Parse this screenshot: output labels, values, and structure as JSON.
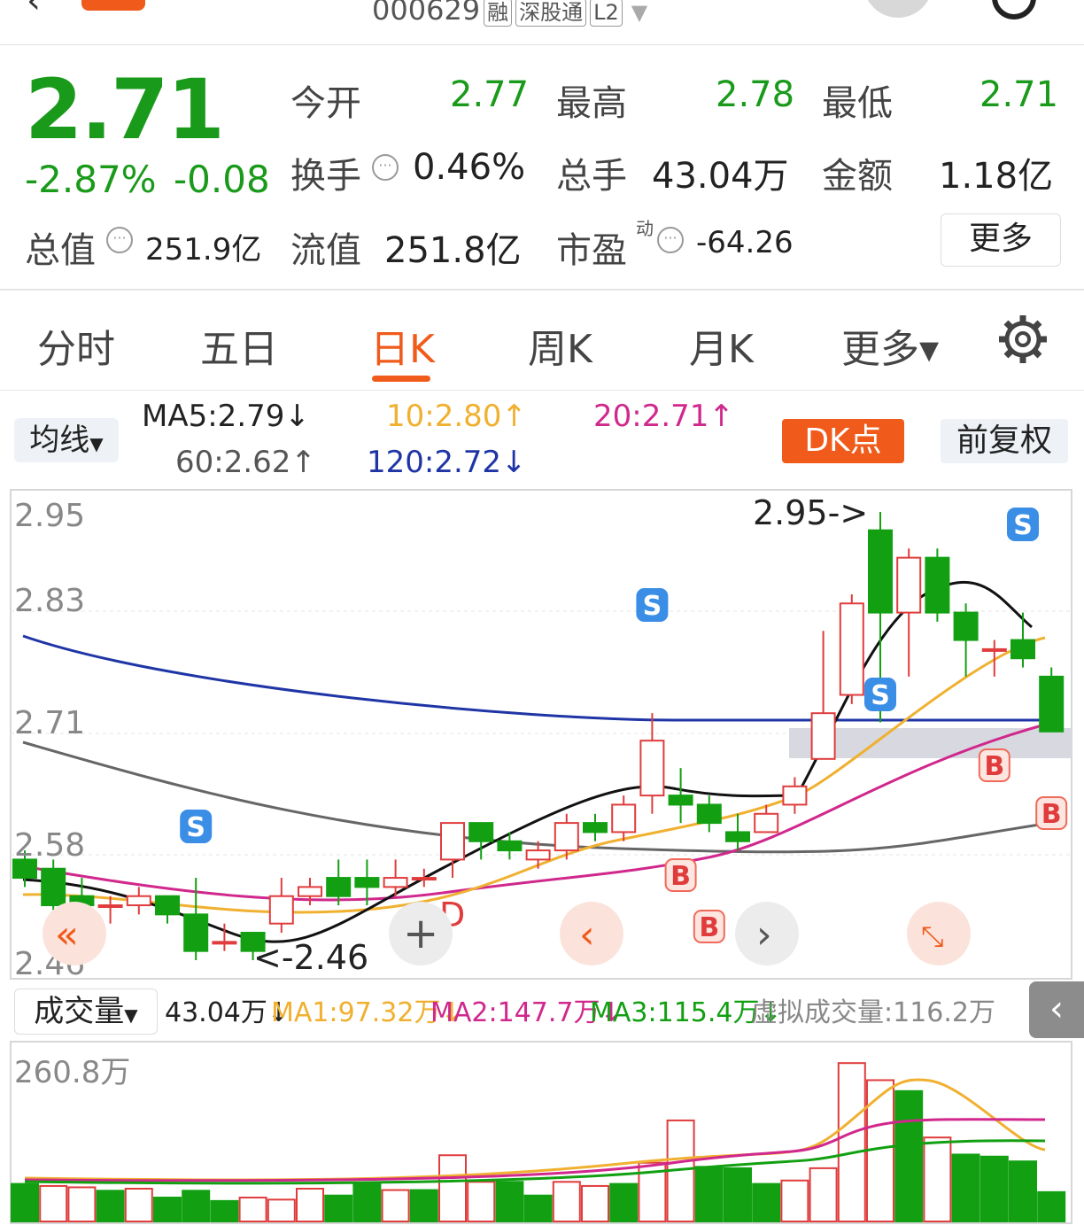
{
  "header": {
    "code": "000629",
    "tags": [
      "融",
      "深股通",
      "L2"
    ]
  },
  "quote": {
    "price": "2.71",
    "change_pct": "-2.87%",
    "change": "-0.08",
    "open_label": "今开",
    "open": "2.77",
    "high_label": "最高",
    "high": "2.78",
    "low_label": "最低",
    "low": "2.71",
    "turnover_label": "换手",
    "turnover": "0.46%",
    "volume_label": "总手",
    "volume": "43.04万",
    "amount_label": "金额",
    "amount": "1.18亿",
    "mktcap_label": "总值",
    "mktcap": "251.9亿",
    "float_label": "流值",
    "float": "251.8亿",
    "pe_label": "市盈",
    "pe_sup": "动",
    "pe": "-64.26",
    "more_label": "更多"
  },
  "tabs": [
    "分时",
    "五日",
    "日K",
    "周K",
    "月K",
    "更多▾"
  ],
  "active_tab": "日K",
  "ma_bar": {
    "selector": "均线",
    "ma5": "MA5:2.79↓",
    "ma10": "10:2.80↑",
    "ma20": "20:2.71↑",
    "ma60": "60:2.62↑",
    "ma120": "120:2.72↓",
    "dk_label": "DK点",
    "adjust_label": "前复权"
  },
  "price_axis": [
    "2.95",
    "2.83",
    "2.71",
    "2.58",
    "2.46"
  ],
  "annotations": {
    "high": "2.95->",
    "low": "<-2.46",
    "d_mark": "D",
    "s": "S",
    "b": "B"
  },
  "volume_bar": {
    "selector": "成交量",
    "vol": "43.04万↓",
    "ma1": "MA1:97.32万↓",
    "ma2": "MA2:147.7万↓",
    "ma3": "MA3:115.4万↓",
    "virtual": "虚拟成交量:116.2万",
    "axis_top": "260.8万"
  },
  "colors": {
    "up": "#e03c3c",
    "down": "#12a012",
    "accent": "#f05a1a",
    "ma5": "#111111",
    "ma10": "#f0b030",
    "ma20": "#d0288c",
    "ma60": "#666666",
    "ma120": "#1f35a5"
  },
  "chart_data": {
    "type": "candlestick",
    "candles": [
      {
        "o": 2.57,
        "c": 2.55,
        "h": 2.58,
        "l": 2.54
      },
      {
        "o": 2.56,
        "c": 2.52,
        "h": 2.57,
        "l": 2.51
      },
      {
        "o": 2.53,
        "c": 2.52,
        "h": 2.55,
        "l": 2.5
      },
      {
        "o": 2.52,
        "c": 2.52,
        "h": 2.53,
        "l": 2.5
      },
      {
        "o": 2.52,
        "c": 2.53,
        "h": 2.54,
        "l": 2.51
      },
      {
        "o": 2.53,
        "c": 2.51,
        "h": 2.53,
        "l": 2.5
      },
      {
        "o": 2.51,
        "c": 2.47,
        "h": 2.55,
        "l": 2.46
      },
      {
        "o": 2.48,
        "c": 2.48,
        "h": 2.5,
        "l": 2.47
      },
      {
        "o": 2.49,
        "c": 2.47,
        "h": 2.49,
        "l": 2.46
      },
      {
        "o": 2.5,
        "c": 2.53,
        "h": 2.55,
        "l": 2.49
      },
      {
        "o": 2.53,
        "c": 2.54,
        "h": 2.55,
        "l": 2.52
      },
      {
        "o": 2.55,
        "c": 2.53,
        "h": 2.57,
        "l": 2.52
      },
      {
        "o": 2.55,
        "c": 2.54,
        "h": 2.57,
        "l": 2.52
      },
      {
        "o": 2.54,
        "c": 2.55,
        "h": 2.57,
        "l": 2.53
      },
      {
        "o": 2.55,
        "c": 2.55,
        "h": 2.56,
        "l": 2.54
      },
      {
        "o": 2.57,
        "c": 2.61,
        "h": 2.61,
        "l": 2.55
      },
      {
        "o": 2.61,
        "c": 2.59,
        "h": 2.61,
        "l": 2.57
      },
      {
        "o": 2.59,
        "c": 2.58,
        "h": 2.6,
        "l": 2.57
      },
      {
        "o": 2.57,
        "c": 2.58,
        "h": 2.59,
        "l": 2.56
      },
      {
        "o": 2.58,
        "c": 2.61,
        "h": 2.62,
        "l": 2.57
      },
      {
        "o": 2.61,
        "c": 2.6,
        "h": 2.62,
        "l": 2.59
      },
      {
        "o": 2.6,
        "c": 2.63,
        "h": 2.64,
        "l": 2.59
      },
      {
        "o": 2.64,
        "c": 2.7,
        "h": 2.73,
        "l": 2.62
      },
      {
        "o": 2.64,
        "c": 2.63,
        "h": 2.67,
        "l": 2.61
      },
      {
        "o": 2.63,
        "c": 2.61,
        "h": 2.64,
        "l": 2.6
      },
      {
        "o": 2.6,
        "c": 2.59,
        "h": 2.62,
        "l": 2.58
      },
      {
        "o": 2.6,
        "c": 2.62,
        "h": 2.63,
        "l": 2.6
      },
      {
        "o": 2.63,
        "c": 2.65,
        "h": 2.66,
        "l": 2.62
      },
      {
        "o": 2.68,
        "c": 2.73,
        "h": 2.82,
        "l": 2.68
      },
      {
        "o": 2.75,
        "c": 2.85,
        "h": 2.86,
        "l": 2.74
      },
      {
        "o": 2.93,
        "c": 2.84,
        "h": 2.95,
        "l": 2.72
      },
      {
        "o": 2.84,
        "c": 2.9,
        "h": 2.91,
        "l": 2.77
      },
      {
        "o": 2.9,
        "c": 2.84,
        "h": 2.91,
        "l": 2.83
      },
      {
        "o": 2.84,
        "c": 2.81,
        "h": 2.85,
        "l": 2.77
      },
      {
        "o": 2.8,
        "c": 2.8,
        "h": 2.81,
        "l": 2.77
      },
      {
        "o": 2.81,
        "c": 2.79,
        "h": 2.84,
        "l": 2.78
      },
      {
        "o": 2.77,
        "c": 2.71,
        "h": 2.78,
        "l": 2.71
      }
    ],
    "volume": [
      {
        "v": 55,
        "up": false
      },
      {
        "v": 52,
        "up": true
      },
      {
        "v": 50,
        "up": true
      },
      {
        "v": 45,
        "up": false
      },
      {
        "v": 48,
        "up": true
      },
      {
        "v": 35,
        "up": false
      },
      {
        "v": 45,
        "up": false
      },
      {
        "v": 30,
        "up": false
      },
      {
        "v": 35,
        "up": true
      },
      {
        "v": 32,
        "up": true
      },
      {
        "v": 48,
        "up": true
      },
      {
        "v": 38,
        "up": false
      },
      {
        "v": 55,
        "up": false
      },
      {
        "v": 46,
        "up": true
      },
      {
        "v": 46,
        "up": false
      },
      {
        "v": 97,
        "up": true
      },
      {
        "v": 58,
        "up": true
      },
      {
        "v": 58,
        "up": false
      },
      {
        "v": 38,
        "up": false
      },
      {
        "v": 58,
        "up": true
      },
      {
        "v": 52,
        "up": true
      },
      {
        "v": 55,
        "up": false
      },
      {
        "v": 86,
        "up": true
      },
      {
        "v": 148,
        "up": true
      },
      {
        "v": 80,
        "up": false
      },
      {
        "v": 78,
        "up": false
      },
      {
        "v": 55,
        "up": false
      },
      {
        "v": 60,
        "up": true
      },
      {
        "v": 78,
        "up": true
      },
      {
        "v": 232,
        "up": true
      },
      {
        "v": 207,
        "up": true
      },
      {
        "v": 191,
        "up": false
      },
      {
        "v": 123,
        "up": true
      },
      {
        "v": 98,
        "up": false
      },
      {
        "v": 95,
        "up": false
      },
      {
        "v": 88,
        "up": false
      },
      {
        "v": 43,
        "up": false
      }
    ],
    "ylim": [
      2.46,
      2.95
    ],
    "vol_max": 260.8
  }
}
